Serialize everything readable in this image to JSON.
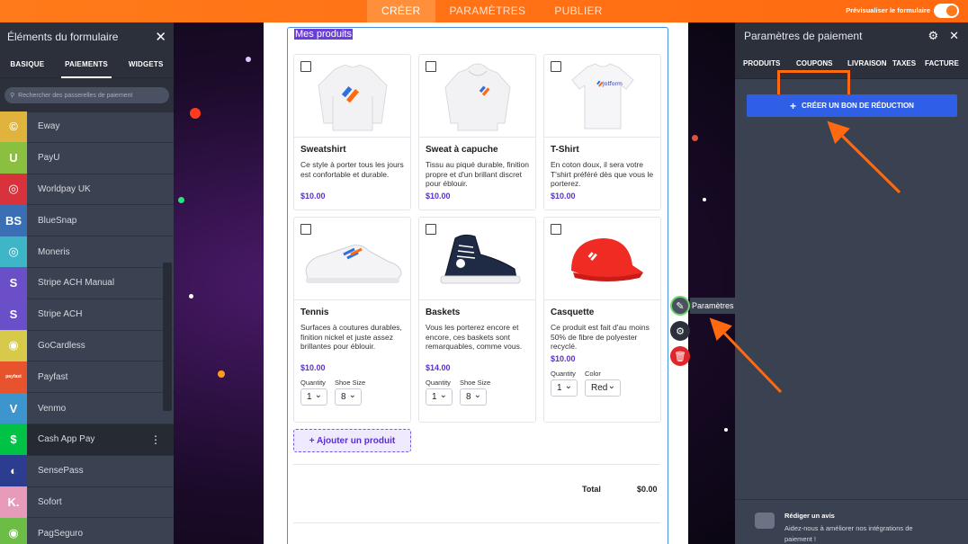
{
  "topbar": {
    "nav": [
      "CRÉER",
      "PARAMÈTRES",
      "PUBLIER"
    ],
    "preview_label": "Prévisualiser le formulaire"
  },
  "left_panel": {
    "title": "Éléments du formulaire",
    "tabs": [
      "BASIQUE",
      "PAIEMENTS",
      "WIDGETS"
    ],
    "active_tab": "PAIEMENTS",
    "search_placeholder": "Rechercher des passerelles de paiement",
    "items": [
      {
        "label": "Eway",
        "icon": "eway-icon",
        "icon_text": "©",
        "color": "#e0b33c"
      },
      {
        "label": "PayU",
        "icon": "payu-icon",
        "icon_text": "U",
        "color": "#8bbf3f"
      },
      {
        "label": "Worldpay UK",
        "icon": "worldpay-icon",
        "icon_text": "◎",
        "color": "#d8333c"
      },
      {
        "label": "BlueSnap",
        "icon": "bluesnap-icon",
        "icon_text": "BS",
        "color": "#3a6fb5"
      },
      {
        "label": "Moneris",
        "icon": "moneris-icon",
        "icon_text": "◎",
        "color": "#3fb6c7"
      },
      {
        "label": "Stripe ACH Manual",
        "icon": "stripe-ach-manual-icon",
        "icon_text": "S",
        "color": "#6a4fc9"
      },
      {
        "label": "Stripe ACH",
        "icon": "stripe-ach-icon",
        "icon_text": "S",
        "color": "#6a4fc9"
      },
      {
        "label": "GoCardless",
        "icon": "gocardless-icon",
        "icon_text": "◉",
        "color": "#d7c94a"
      },
      {
        "label": "Payfast",
        "icon": "payfast-icon",
        "icon_text": "payfast",
        "color": "#e6532d"
      },
      {
        "label": "Venmo",
        "icon": "venmo-icon",
        "icon_text": "V",
        "color": "#3d95ce"
      },
      {
        "label": "Cash App Pay",
        "icon": "cash-app-icon",
        "icon_text": "$",
        "color": "#00c244"
      },
      {
        "label": "SensePass",
        "icon": "sensepass-icon",
        "icon_text": "◐",
        "color": "#2c3d8f"
      },
      {
        "label": "Sofort",
        "icon": "sofort-icon",
        "icon_text": "K.",
        "color": "#e89abb"
      },
      {
        "label": "PagSeguro",
        "icon": "pagseguro-icon",
        "icon_text": "◉",
        "color": "#6bbd45"
      }
    ],
    "selected_item": "Cash App Pay"
  },
  "form": {
    "title": "Mes produits",
    "products": [
      {
        "name": "Sweatshirt",
        "desc": "Ce style à porter tous les jours est confortable et durable.",
        "price": "$10.00",
        "image": "sweatshirt"
      },
      {
        "name": "Sweat à capuche",
        "desc": "Tissu au piqué durable, finition propre et d'un brillant discret pour éblouir.",
        "price": "$10.00",
        "image": "hoodie"
      },
      {
        "name": "T-Shirt",
        "desc": "En coton doux, il sera votre T'shirt préféré dès que vous le porterez.",
        "price": "$10.00",
        "image": "tshirt"
      },
      {
        "name": "Tennis",
        "desc": "Surfaces à coutures durables, finition nickel et juste assez brillantes pour éblouir.",
        "price": "$10.00",
        "image": "tennis",
        "opts": [
          {
            "label": "Quantity",
            "value": "1"
          },
          {
            "label": "Shoe Size",
            "value": "8"
          }
        ]
      },
      {
        "name": "Baskets",
        "desc": "Vous les porterez encore et encore, ces baskets sont remarquables, comme vous.",
        "price": "$14.00",
        "image": "baskets",
        "opts": [
          {
            "label": "Quantity",
            "value": "1"
          },
          {
            "label": "Shoe Size",
            "value": "8"
          }
        ]
      },
      {
        "name": "Casquette",
        "desc": "Ce produit est fait d'au moins 50% de fibre de polyester recyclé.",
        "price": "$10.00",
        "image": "cap",
        "opts": [
          {
            "label": "Quantity",
            "value": "1"
          },
          {
            "label": "Color",
            "value": "Red"
          }
        ]
      }
    ],
    "add_product": "+ Ajouter un produit",
    "total_label": "Total",
    "total_value": "$0.00"
  },
  "tools": {
    "tooltip": "Paramètres"
  },
  "right_panel": {
    "title": "Paramètres de paiement",
    "tabs": [
      "PRODUITS",
      "COUPONS",
      "LIVRAISON",
      "TAXES",
      "FACTURE"
    ],
    "active_tab": "COUPONS",
    "coupon_button": "CRÉER UN BON DE RÉDUCTION",
    "review_title": "Rédiger un avis",
    "review_text": "Aidez-nous à améliorer nos intégrations de paiement !"
  },
  "colors": {
    "accent_orange": "#ff6a10",
    "brand_purple": "#5a2fd0",
    "button_blue": "#2f5fe6"
  }
}
